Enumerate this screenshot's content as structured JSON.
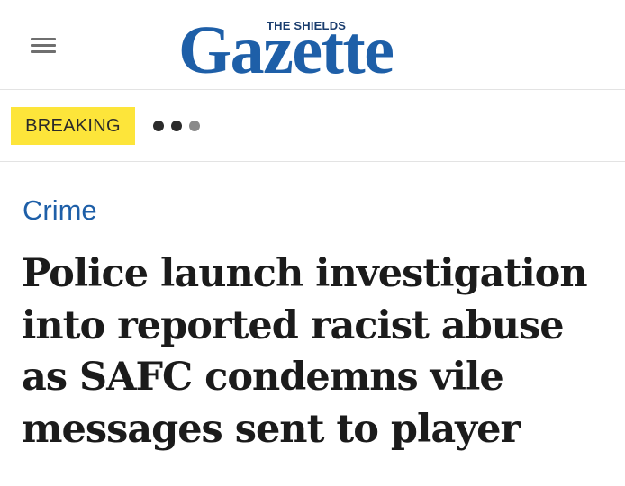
{
  "header": {
    "menu_icon": "hamburger-menu-icon",
    "logo": {
      "kicker": "THE SHIELDS",
      "wordmark": "Gazette",
      "kicker_color": "#1a3d6e",
      "wordmark_color": "#1e5fa8"
    }
  },
  "breaking": {
    "label": "BREAKING",
    "badge_color": "#fde53a",
    "indicator_icon": "more-dots-icon"
  },
  "article": {
    "section": "Crime",
    "section_color": "#1e5fa8",
    "headline": "Police launch investigation into reported racist abuse as SAFC condemns vile messages sent to player"
  }
}
